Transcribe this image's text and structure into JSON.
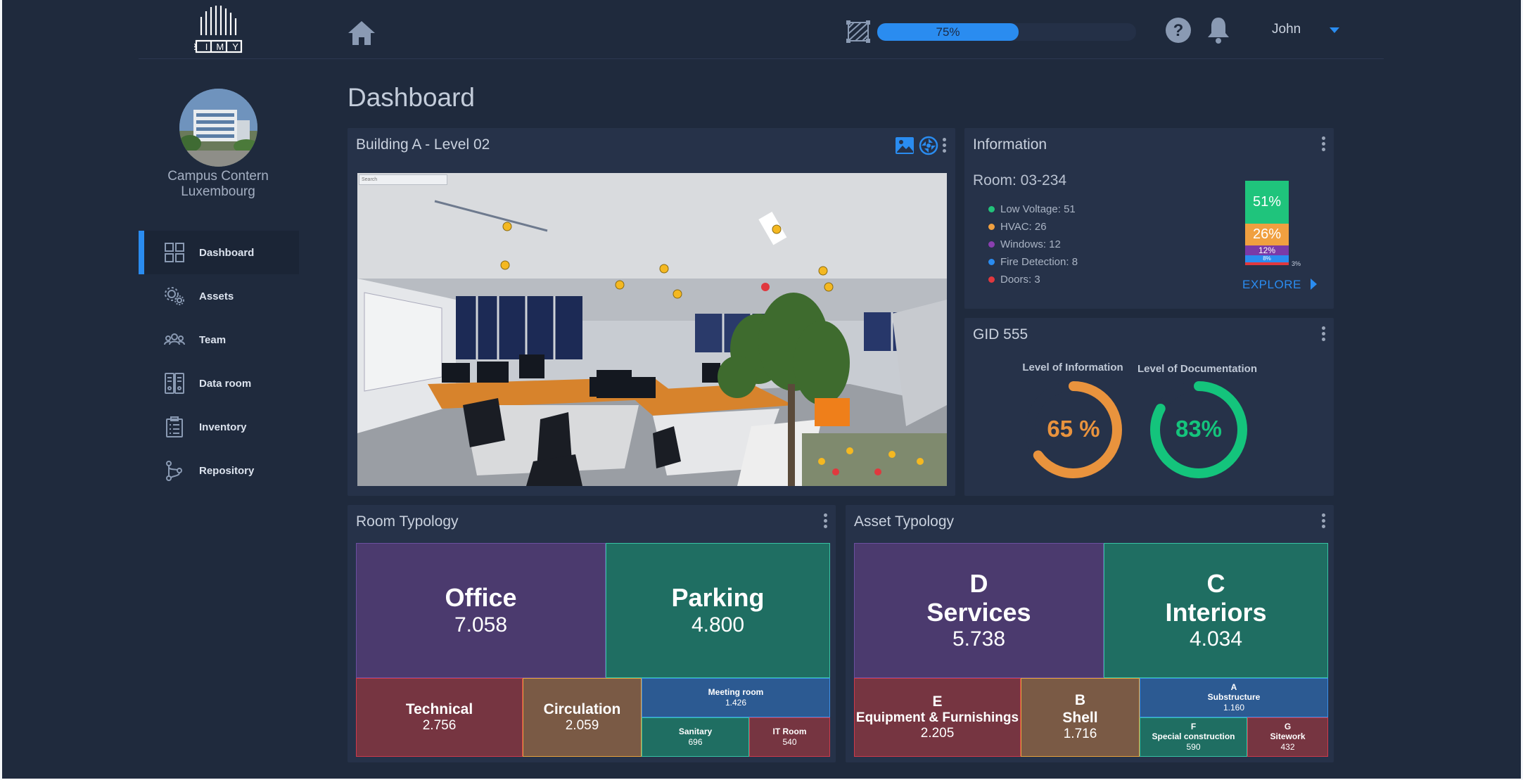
{
  "app": {
    "logo_text": "BIMY"
  },
  "topbar": {
    "progress_value": 75,
    "progress_label": "75%",
    "user_name": "John"
  },
  "sidebar": {
    "campus_name_line1": "Campus Contern",
    "campus_name_line2": "Luxembourg",
    "items": [
      {
        "label": "Dashboard",
        "icon": "dashboard-grid-icon",
        "active": true
      },
      {
        "label": "Assets",
        "icon": "assets-gear-icon",
        "active": false
      },
      {
        "label": "Team",
        "icon": "team-icon",
        "active": false
      },
      {
        "label": "Data room",
        "icon": "data-room-icon",
        "active": false
      },
      {
        "label": "Inventory",
        "icon": "clipboard-icon",
        "active": false
      },
      {
        "label": "Repository",
        "icon": "repository-branch-icon",
        "active": false
      }
    ]
  },
  "page": {
    "title": "Dashboard"
  },
  "viewer": {
    "title": "Building A - Level 02",
    "search_placeholder": "Search"
  },
  "information": {
    "title": "Information",
    "room": "Room: 03-234",
    "items": [
      {
        "label": "Low Voltage: 51",
        "color": "#22c27a"
      },
      {
        "label": "HVAC: 26",
        "color": "#f0a040"
      },
      {
        "label": "Windows: 12",
        "color": "#8a3fb0"
      },
      {
        "label": "Fire Detection: 8",
        "color": "#2a8cf0"
      },
      {
        "label": "Doors: 3",
        "color": "#e0383e"
      }
    ],
    "stack": [
      {
        "label": "51%",
        "value": 51,
        "color": "#1fc47c"
      },
      {
        "label": "26%",
        "value": 26,
        "color": "#f0a040"
      },
      {
        "label": "12%",
        "value": 12,
        "color": "#7a3aa8"
      },
      {
        "label": "8%",
        "value": 8,
        "color": "#2a8cf0"
      },
      {
        "label": "",
        "value": 3,
        "color": "#e0383e"
      }
    ],
    "stack_note": "3%",
    "explore_label": "EXPLORE"
  },
  "gid": {
    "title": "GID 555",
    "loi_label": "Level of Information",
    "loi_value": 65,
    "loi_text": "65 %",
    "loi_color": "#e9933d",
    "lod_label": "Level of Documentation",
    "lod_value": 83,
    "lod_text": "83%",
    "lod_color": "#14c47c"
  },
  "room_typology": {
    "title": "Room Typology",
    "tiles": [
      {
        "name": "Office",
        "value": "7.058",
        "color": "#4b3a6e",
        "border": "#6b4fa0"
      },
      {
        "name": "Parking",
        "value": "4.800",
        "color": "#1f6e62",
        "border": "#37c2a4"
      },
      {
        "name": "Technical",
        "value": "2.756",
        "color": "#763541",
        "border": "#cf3a4b"
      },
      {
        "name": "Circulation",
        "value": "2.059",
        "color": "#7a5a45",
        "border": "#e8a33c"
      },
      {
        "name": "Meeting room",
        "value": "1.426",
        "color": "#2c5a92",
        "border": "#3c8fe6"
      },
      {
        "name": "Sanitary",
        "value": "696",
        "color": "#1f6e62",
        "border": "#37c2a4"
      },
      {
        "name": "IT Room",
        "value": "540",
        "color": "#763541",
        "border": "#cf3a4b"
      }
    ]
  },
  "asset_typology": {
    "title": "Asset Typology",
    "tiles": [
      {
        "code": "D",
        "name": "Services",
        "value": "5.738",
        "color": "#4b3a6e",
        "border": "#6b4fa0"
      },
      {
        "code": "C",
        "name": "Interiors",
        "value": "4.034",
        "color": "#1f6e62",
        "border": "#37c2a4"
      },
      {
        "code": "E",
        "name": "Equipment & Furnishings",
        "value": "2.205",
        "color": "#763541",
        "border": "#cf3a4b"
      },
      {
        "code": "B",
        "name": "Shell",
        "value": "1.716",
        "color": "#7a5a45",
        "border": "#e8a33c"
      },
      {
        "code": "A",
        "name": "Substructure",
        "value": "1.160",
        "color": "#2c5a92",
        "border": "#3c8fe6"
      },
      {
        "code": "F",
        "name": "Special construction",
        "value": "590",
        "color": "#1f6e62",
        "border": "#37c2a4"
      },
      {
        "code": "G",
        "name": "Sitework",
        "value": "432",
        "color": "#763541",
        "border": "#cf3a4b"
      }
    ]
  }
}
